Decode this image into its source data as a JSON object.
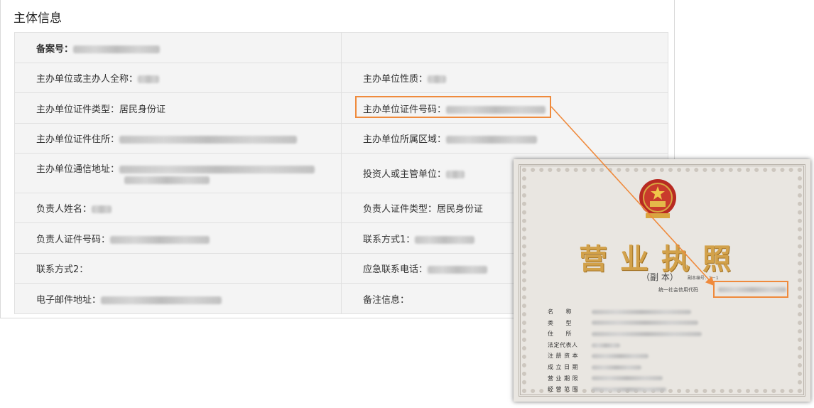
{
  "panel": {
    "title": "主体信息"
  },
  "rows": [
    {
      "left_label": "备案号：",
      "left_value": "",
      "right_label": "",
      "right_value": ""
    },
    {
      "left_label": "主办单位或主办人全称：",
      "left_value": "",
      "right_label": "主办单位性质：",
      "right_value": ""
    },
    {
      "left_label": "主办单位证件类型：居民身份证",
      "left_value": "",
      "right_label": "主办单位证件号码：",
      "right_value": ""
    },
    {
      "left_label": "主办单位证件住所：",
      "left_value": "",
      "right_label": "主办单位所属区域：",
      "right_value": ""
    },
    {
      "left_label": "主办单位通信地址：",
      "left_value": "",
      "right_label": "投资人或主管单位：",
      "right_value": ""
    },
    {
      "left_label": "负责人姓名：",
      "left_value": "",
      "right_label": "负责人证件类型：居民身份证",
      "right_value": ""
    },
    {
      "left_label": "负责人证件号码：",
      "left_value": "",
      "right_label": "联系方式1：",
      "right_value": ""
    },
    {
      "left_label": "联系方式2：",
      "left_value": "",
      "right_label": "应急联系电话：",
      "right_value": ""
    },
    {
      "left_label": "电子邮件地址：",
      "left_value": "",
      "right_label": "备注信息：",
      "right_value": ""
    }
  ],
  "license": {
    "title": "营业执照",
    "subtitle": "（副 本）",
    "copy_no": "副本编号：1－1",
    "credit_code_label": "统一社会信用代码",
    "fields": [
      "名　　称",
      "类　　型",
      "住　　所",
      "法定代表人",
      "注 册 资 本",
      "成 立 日 期",
      "营 业 期 限",
      "经 营 范 围"
    ]
  },
  "colors": {
    "highlight": "#ef8a3c",
    "table_bg": "#f4f4f4",
    "border": "#e0e0e0"
  }
}
